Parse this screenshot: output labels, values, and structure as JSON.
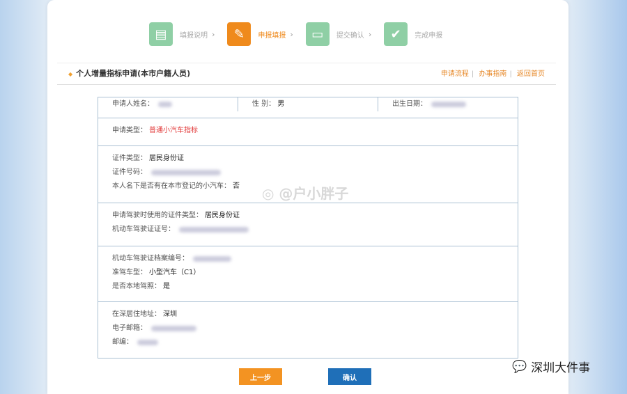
{
  "steps": [
    {
      "label": "填报说明",
      "icon": "document-icon",
      "active": false
    },
    {
      "label": "申报填报",
      "icon": "edit-icon",
      "active": true
    },
    {
      "label": "提交确认",
      "icon": "tablet-icon",
      "active": false
    },
    {
      "label": "完成申报",
      "icon": "check-icon",
      "active": false
    }
  ],
  "header": {
    "title": "个人增量指标申请(本市户籍人员)",
    "links": [
      "申请流程",
      "办事指南",
      "返回首页"
    ]
  },
  "form": {
    "name_label": "申请人姓名：",
    "gender_label": "性 别：",
    "gender_value": "男",
    "birth_label": "出生日期：",
    "type_label": "申请类型：",
    "type_value": "普通小汽车指标",
    "id_type_label": "证件类型：",
    "id_type_value": "居民身份证",
    "id_no_label": "证件号码：",
    "car_label": "本人名下是否有在本市登记的小汽车：",
    "car_value": "否",
    "apply_id_type_label": "申请驾驶时使用的证件类型：",
    "apply_id_type_value": "居民身份证",
    "license_no_label": "机动车驾驶证证号：",
    "license_file_label": "机动车驾驶证档案编号：",
    "class_label": "准驾车型：",
    "class_value": "小型汽车（C1）",
    "local_label": "是否本地驾照：",
    "local_value": "是",
    "address_label": "在深居住地址：",
    "address_value": "深圳",
    "email_label": "电子邮箱：",
    "zip_label": "邮编："
  },
  "buttons": {
    "prev": "上一步",
    "confirm": "确认"
  },
  "watermarks": {
    "weibo": "@户小胖子",
    "wechat": "深圳大件事"
  }
}
